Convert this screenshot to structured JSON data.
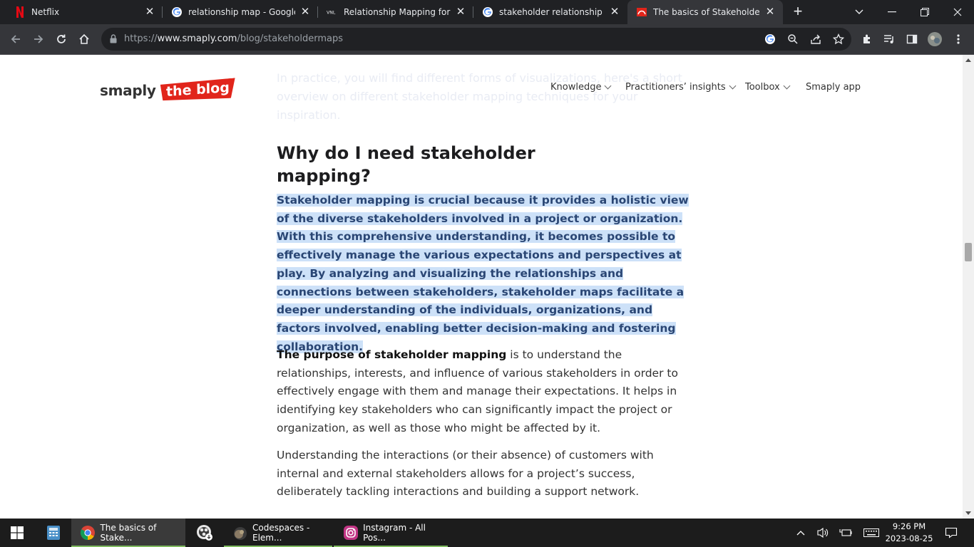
{
  "browser": {
    "tabs": [
      {
        "title": "Netflix",
        "icon": "netflix-icon"
      },
      {
        "title": "relationship map - Google Se",
        "icon": "google-icon"
      },
      {
        "title": "Relationship Mapping for Pul",
        "icon": "vnl-icon"
      },
      {
        "title": "stakeholder relationship map",
        "icon": "google-icon"
      },
      {
        "title": "The basics of Stakeholder Ma",
        "icon": "smaply-icon",
        "active": true
      }
    ],
    "url_prefix": "https://",
    "url_domain": "www.smaply.com",
    "url_path": "/blog/stakeholdermaps"
  },
  "site": {
    "logo_word": "smaply",
    "logo_badge": "the blog",
    "nav": [
      "Knowledge",
      "Practitioners’ insights",
      "Toolbox",
      "Smaply app"
    ],
    "faded_text": "In practice, you will find different forms of visualizations, here's a short overview on different stakeholder mapping techniques for your inspiration."
  },
  "article": {
    "heading": "Why do I need stakeholder mapping?",
    "highlighted": "Stakeholder mapping is crucial because it provides a holistic view of the diverse stakeholders involved in a project or organization. With this comprehensive understanding, it becomes possible to effectively manage the various expectations and perspectives at play. By analyzing and visualizing the relationships and connections between stakeholders, stakeholder maps facilitate a deeper understanding of the individuals, organizations, and factors involved, enabling better decision-making and fostering collaboration.",
    "p1_strong": "The purpose of stakeholder mapping",
    "p1_rest": " is to understand the relationships, interests, and influence of various stakeholders in order to effectively engage with them and manage their expectations. It helps in identifying key stakeholders who can significantly impact the project or organization, as well as those who might be affected by it.",
    "p2": "Understanding the interactions (or their absence) of customers with internal and external stakeholders allows for a project’s success, deliberately tackling interactions and building a support network."
  },
  "taskbar": {
    "apps": [
      {
        "label": "The basics of Stake...",
        "icon": "chrome-icon"
      },
      {
        "label": "",
        "icon": "obs-icon"
      },
      {
        "label": "Codespaces - Elem...",
        "icon": "app-icon"
      },
      {
        "label": "Instagram - All Pos...",
        "icon": "instagram-icon"
      }
    ],
    "time": "9:26 PM",
    "date": "2023-08-25"
  },
  "colors": {
    "accent_red": "#e1251b",
    "highlight": "#cde1f8",
    "highlight_text": "#2a4674"
  }
}
